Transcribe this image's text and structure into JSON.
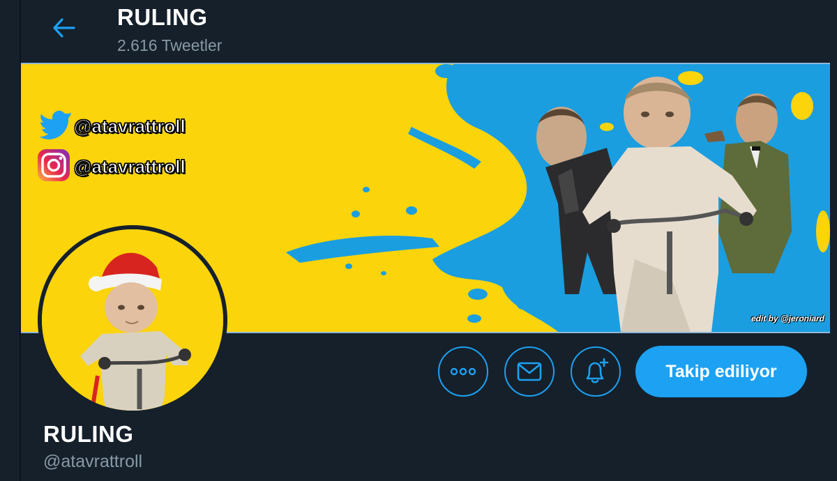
{
  "header": {
    "title": "RULING",
    "tweet_count": "2.616 Tweetler"
  },
  "banner": {
    "twitter_handle": "@atavrattroll",
    "instagram_handle": "@atavrattroll",
    "credit": "edit by @jeroniard"
  },
  "profile": {
    "display_name": "RULING",
    "handle": "@atavrattroll"
  },
  "actions": {
    "follow_label": "Takip ediliyor",
    "more_label": "Daha fazla",
    "message_label": "Mesaj",
    "notify_label": "Bildirimler"
  },
  "colors": {
    "background": "#15202b",
    "accent": "#1da1f2",
    "banner_yellow": "#fbd40b",
    "splash_blue": "#1a9ee0",
    "secondary_text": "#8899a6"
  },
  "icons": {
    "back": "arrow-left-icon",
    "more": "more-dots-icon",
    "message": "mail-icon",
    "notify": "bell-plus-icon",
    "twitter": "twitter-bird-icon",
    "instagram": "instagram-icon"
  }
}
